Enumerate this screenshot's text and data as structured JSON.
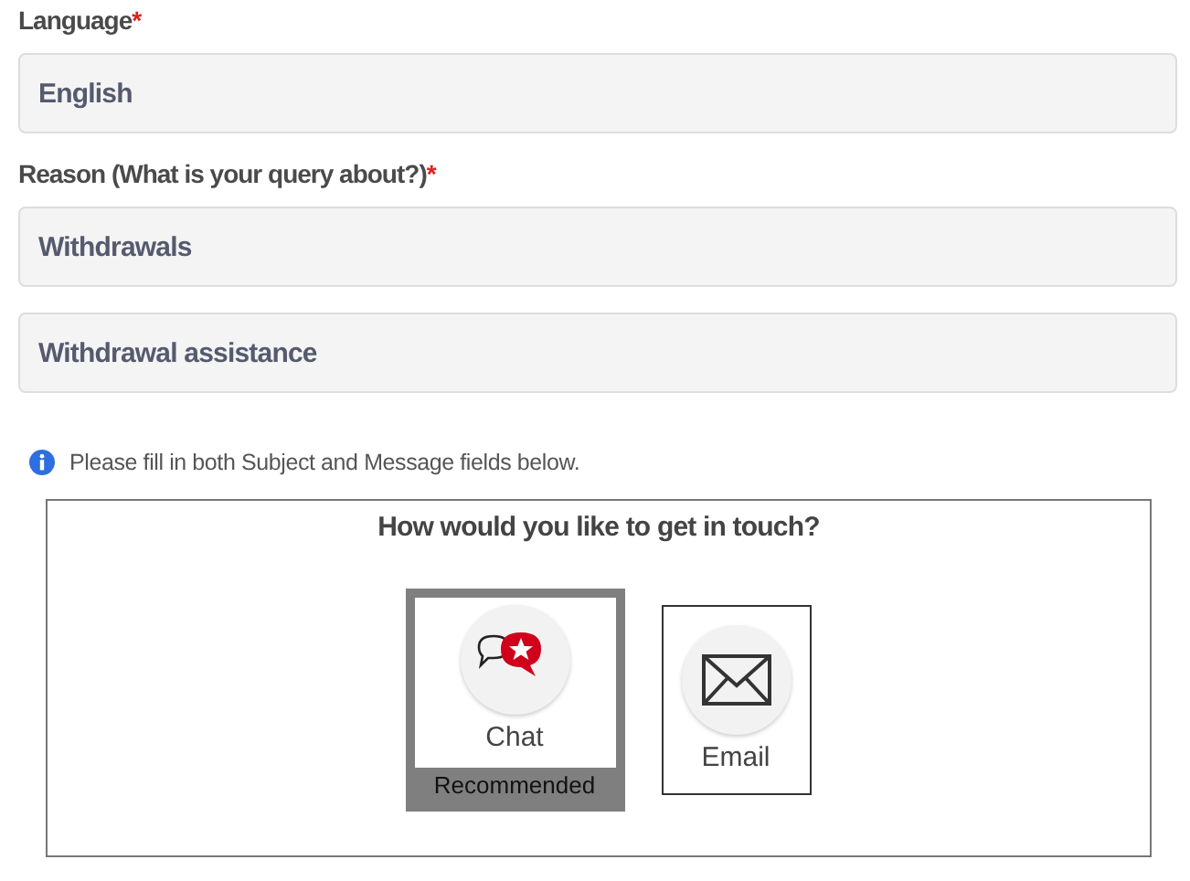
{
  "fields": [
    {
      "label": "Language",
      "required_mark": "*",
      "values": [
        "English"
      ]
    },
    {
      "label": "Reason (What is your query about?)",
      "required_mark": "*",
      "values": [
        "Withdrawals",
        "Withdrawal assistance"
      ]
    }
  ],
  "info": "Please fill in both Subject and Message fields below.",
  "contact": {
    "title": "How would you like to get in touch?",
    "options": [
      {
        "kind": "chat",
        "label": "Chat",
        "badge": "Recommended",
        "selected": true
      },
      {
        "kind": "email",
        "label": "Email",
        "selected": false
      }
    ]
  }
}
